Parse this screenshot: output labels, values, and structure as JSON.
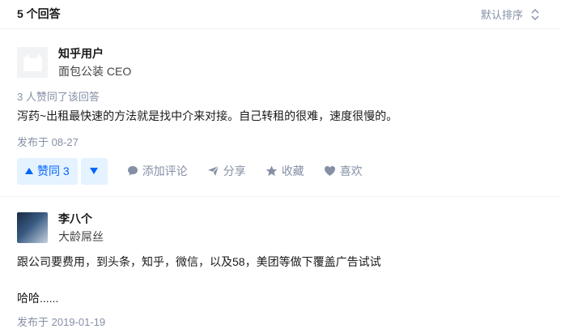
{
  "header": {
    "title": "5 个回答",
    "sort_label": "默认排序"
  },
  "answers": [
    {
      "author": "知乎用户",
      "bio": "面包公装 CEO",
      "voters": "3 人赞同了该回答",
      "content": "泻药~出租最快速的方法就是找中介来对接。自己转租的很难，速度很慢的。",
      "date": "发布于 08-27",
      "actions": {
        "upvote": "赞同 3",
        "comment": "添加评论",
        "share": "分享",
        "collect": "收藏",
        "like": "喜欢"
      }
    },
    {
      "author": "李八个",
      "bio": "大龄屌丝",
      "content_line1": "跟公司要费用，到头条，知乎，微信，以及58，美团等做下覆盖广告试试",
      "content_line2": "哈哈......",
      "date": "发布于 2019-01-19"
    }
  ],
  "colors": {
    "accent": "#0066ff",
    "accent_bg": "#e5f2ff",
    "muted": "#8590a6"
  }
}
